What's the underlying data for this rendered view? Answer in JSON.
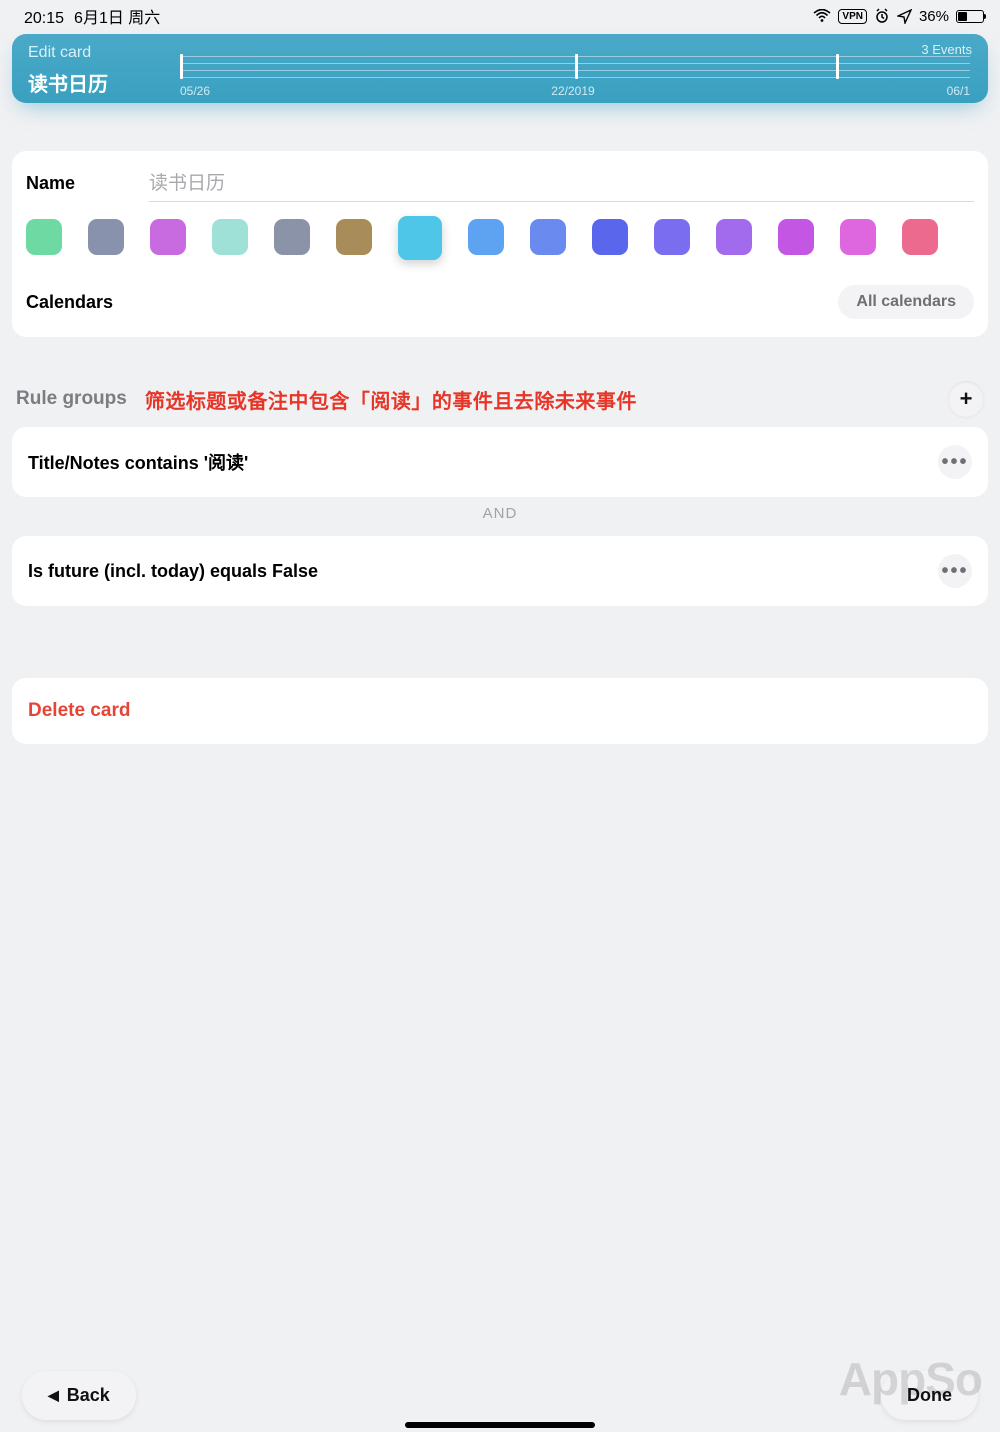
{
  "status": {
    "time": "20:15",
    "date": "6月1日 周六",
    "vpn": "VPN",
    "battery_percent": "36%"
  },
  "header": {
    "edit_label": "Edit card",
    "title": "读书日历",
    "events_count": "3 Events",
    "timeline": {
      "left": "05/26",
      "mid": "22/2019",
      "right": "06/1"
    }
  },
  "name_section": {
    "label": "Name",
    "value": "读书日历"
  },
  "colors": [
    {
      "hex": "#6fd9a4",
      "selected": false
    },
    {
      "hex": "#8892ad",
      "selected": false
    },
    {
      "hex": "#c96be0",
      "selected": false
    },
    {
      "hex": "#9fe1d6",
      "selected": false
    },
    {
      "hex": "#8a93a8",
      "selected": false
    },
    {
      "hex": "#a88d5a",
      "selected": false
    },
    {
      "hex": "#4ec6e8",
      "selected": true
    },
    {
      "hex": "#5da3f2",
      "selected": false
    },
    {
      "hex": "#6a8af0",
      "selected": false
    },
    {
      "hex": "#5a66ec",
      "selected": false
    },
    {
      "hex": "#7a6df0",
      "selected": false
    },
    {
      "hex": "#a26aed",
      "selected": false
    },
    {
      "hex": "#c356e2",
      "selected": false
    },
    {
      "hex": "#de67e0",
      "selected": false
    },
    {
      "hex": "#ec6a8d",
      "selected": false
    }
  ],
  "calendars": {
    "label": "Calendars",
    "pill": "All calendars"
  },
  "rule_section": {
    "title": "Rule groups",
    "note": "筛选标题或备注中包含「阅读」的事件且去除未来事件",
    "add": "+",
    "rules": [
      {
        "text": "Title/Notes contains '阅读'"
      },
      {
        "text": "Is future (incl. today) equals False"
      }
    ],
    "connector": "AND"
  },
  "delete": {
    "label": "Delete card"
  },
  "footer": {
    "back": "Back",
    "done": "Done"
  },
  "watermark": "AppSo"
}
